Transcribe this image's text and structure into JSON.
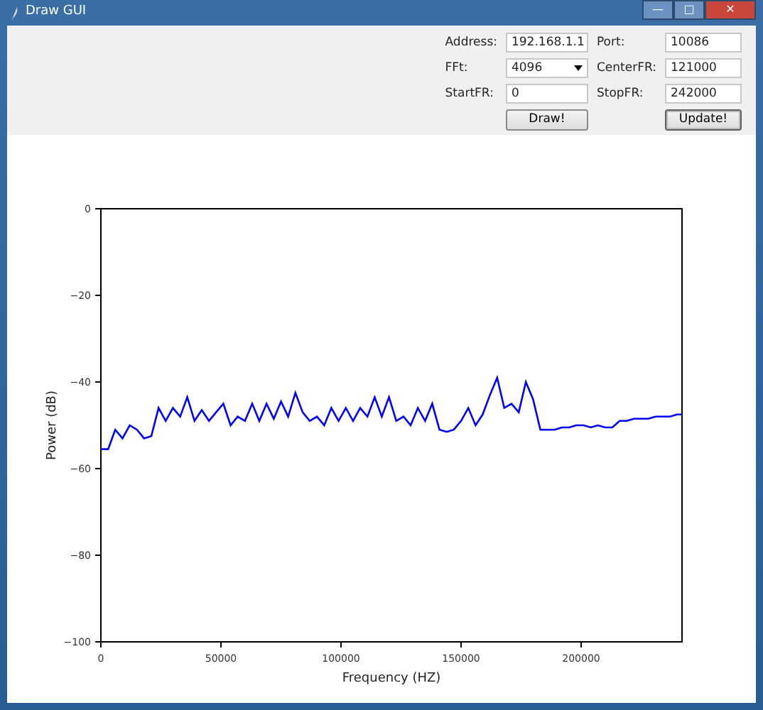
{
  "window": {
    "title": "Draw GUI",
    "controls": [
      "—",
      "□",
      "✕"
    ]
  },
  "form": {
    "fields": [
      {
        "label": "Address:",
        "value": "192.168.1.1",
        "kind": "text"
      },
      {
        "label": "Port:",
        "value": "10086",
        "kind": "text"
      },
      {
        "label": "FFt:",
        "value": "4096",
        "kind": "dropdown"
      },
      {
        "label": "CenterFR:",
        "value": "121000",
        "kind": "text"
      },
      {
        "label": "StartFR:",
        "value": "0",
        "kind": "text"
      },
      {
        "label": "StopFR:",
        "value": "242000",
        "kind": "text"
      }
    ],
    "buttons": [
      {
        "label": "Draw!",
        "selected": false
      },
      {
        "label": "Update!",
        "selected": true
      }
    ]
  },
  "plot": {
    "chart_data": {
      "type": "line",
      "xlabel": "Frequency (HZ)",
      "ylabel": "Power (dB)",
      "xlim": [
        0,
        242000
      ],
      "ylim": [
        -100,
        0
      ],
      "xticks": [
        0,
        50000,
        100000,
        150000,
        200000
      ],
      "yticks": [
        0,
        -20,
        -40,
        -60,
        -80,
        -100
      ],
      "x": [
        0,
        3000,
        6000,
        9000,
        12000,
        15000,
        18000,
        21000,
        24000,
        27000,
        30000,
        33000,
        36000,
        39000,
        42000,
        45000,
        48000,
        51000,
        54000,
        57000,
        60000,
        63000,
        66000,
        69000,
        72000,
        75000,
        78000,
        81000,
        84000,
        87000,
        90000,
        93000,
        96000,
        99000,
        102000,
        105000,
        108000,
        111000,
        114000,
        117000,
        120000,
        123000,
        126000,
        129000,
        132000,
        135000,
        138000,
        141000,
        144000,
        147000,
        150000,
        153000,
        156000,
        159000,
        162000,
        165000,
        168000,
        171000,
        174000,
        177000,
        180000,
        183000,
        186000,
        189000,
        192000,
        195000,
        198000,
        201000,
        204000,
        207000,
        210000,
        213000,
        216000,
        219000,
        222000,
        225000,
        228000,
        231000,
        234000,
        237000,
        240000,
        242000
      ],
      "series": [
        {
          "color": "#0000ff",
          "values": [
            -55.5,
            -55.5,
            -51,
            -53,
            -50,
            -51,
            -53,
            -52.5,
            -46,
            -49,
            -46,
            -48,
            -43.5,
            -49,
            -46.5,
            -49,
            -47,
            -45,
            -50,
            -48,
            -49,
            -45,
            -49,
            -45,
            -48.5,
            -44.5,
            -48,
            -42.5,
            -47,
            -49,
            -48,
            -50,
            -46,
            -49,
            -46,
            -49,
            -46,
            -48,
            -43.5,
            -48,
            -43.5,
            -49,
            -48,
            -50,
            -46,
            -49,
            -45,
            -51,
            -51.5,
            -51,
            -49,
            -46,
            -50,
            -47.5,
            -43,
            -39,
            -46,
            -45,
            -47,
            -40,
            -44,
            -51,
            -51,
            -51,
            -50.5,
            -50.5,
            -50,
            -50,
            -50.5,
            -50,
            -50.5,
            -50.5,
            -49,
            -49,
            -48.5,
            -48.5,
            -48.5,
            -48,
            -48,
            -48,
            -47.5,
            -47.5
          ]
        }
      ]
    }
  }
}
